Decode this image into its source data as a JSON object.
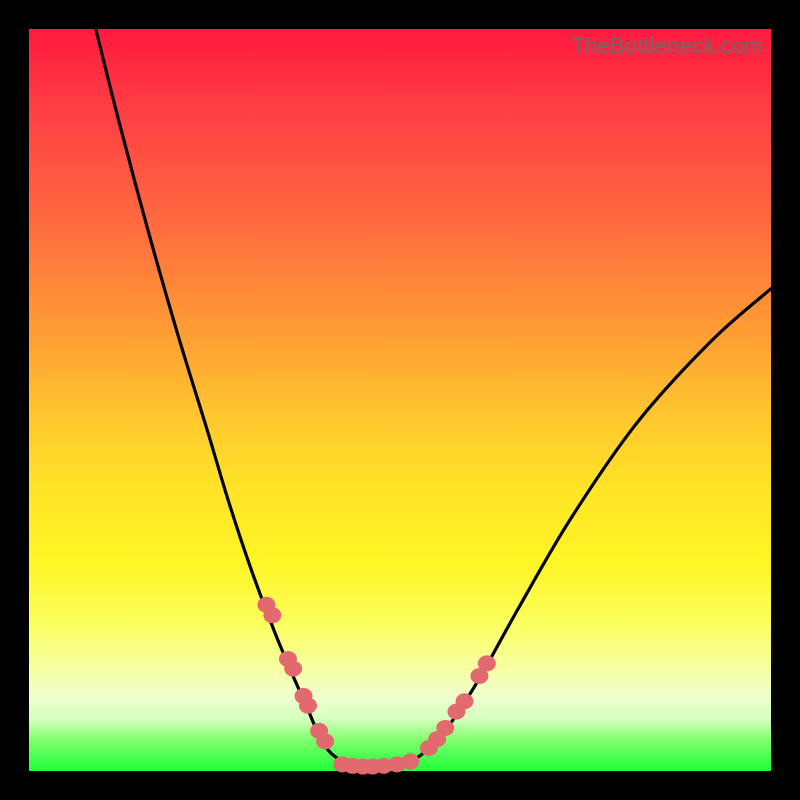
{
  "attribution": "TheBottleneck.com",
  "colors": {
    "frame": "#000000",
    "curve_stroke": "#000000",
    "marker_fill": "#e26a6e",
    "marker_stroke": "#c95257",
    "gradient_top": "#ff1a3f",
    "gradient_bottom": "#1cff3a"
  },
  "chart_data": {
    "type": "line",
    "title": "",
    "xlabel": "",
    "ylabel": "",
    "xlim": [
      0,
      100
    ],
    "ylim": [
      0,
      100
    ],
    "grid": false,
    "legend": false,
    "notes": "U/V-shaped bottleneck curve with scattered marker points near the valley. Background vertical gradient encodes value (red=high, green=low). No axis ticks or numeric labels are shown; x and ylim are nominal 0–100 for positioning.",
    "series": [
      {
        "name": "bottleneck-curve",
        "kind": "path",
        "x": [
          9,
          12,
          16,
          20,
          24,
          27,
          30,
          33,
          35.5,
          37.5,
          39,
          40.5,
          42.5,
          45,
          48,
          51,
          53,
          55,
          57.5,
          61,
          66,
          73,
          82,
          92,
          100
        ],
        "y": [
          100,
          88,
          73,
          59,
          46,
          36,
          27,
          19,
          13,
          8.5,
          5,
          2.6,
          1.2,
          0.5,
          0.5,
          1.1,
          2.3,
          4.2,
          7.4,
          13,
          22,
          34,
          47,
          58,
          65
        ]
      },
      {
        "name": "left-arm-markers",
        "kind": "scatter",
        "x": [
          32.0,
          32.8,
          34.9,
          35.6,
          37.0,
          37.6,
          39.1,
          39.9
        ],
        "y": [
          22.4,
          21.0,
          15.1,
          13.8,
          10.1,
          8.8,
          5.4,
          4.0
        ]
      },
      {
        "name": "valley-floor-markers",
        "kind": "scatter",
        "x": [
          42.2,
          43.6,
          45.0,
          46.3,
          47.8,
          49.6,
          51.4
        ],
        "y": [
          0.9,
          0.7,
          0.6,
          0.6,
          0.7,
          0.9,
          1.3
        ]
      },
      {
        "name": "right-arm-markers",
        "kind": "scatter",
        "x": [
          53.9,
          55.0,
          56.1,
          57.6,
          58.7,
          60.7,
          61.7
        ],
        "y": [
          3.1,
          4.3,
          5.8,
          8.0,
          9.4,
          12.8,
          14.5
        ]
      }
    ]
  }
}
